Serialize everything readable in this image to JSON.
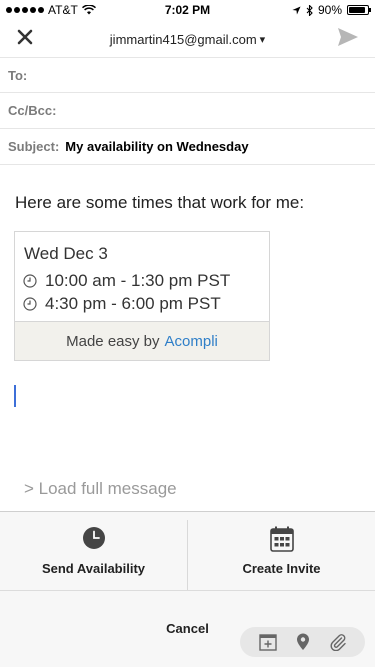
{
  "status_bar": {
    "carrier": "AT&T",
    "time": "7:02 PM",
    "battery": "90%",
    "battery_level": 0.9
  },
  "nav": {
    "from_account": "jimmartin415@gmail.com",
    "from_caret": "▾",
    "close_icon": "close-icon",
    "send_icon": "send-icon"
  },
  "compose": {
    "to_label": "To:",
    "cc_label": "Cc/Bcc:",
    "subject_label": "Subject:",
    "subject_value": "My availability on Wednesday",
    "intro": "Here are some times that work for me:",
    "availability": {
      "date": "Wed Dec 3",
      "slots": [
        "10:00 am - 1:30 pm PST",
        "4:30 pm - 6:00 pm PST"
      ],
      "footer_prefix": "Made easy by",
      "footer_brand": "Acompli"
    },
    "load_full": "> Load full message"
  },
  "action_sheet": {
    "send_availability": "Send Availability",
    "create_invite": "Create Invite",
    "cancel": "Cancel"
  },
  "colors": {
    "accent": "#2f7fc8",
    "cursor": "#3d6fd8"
  }
}
